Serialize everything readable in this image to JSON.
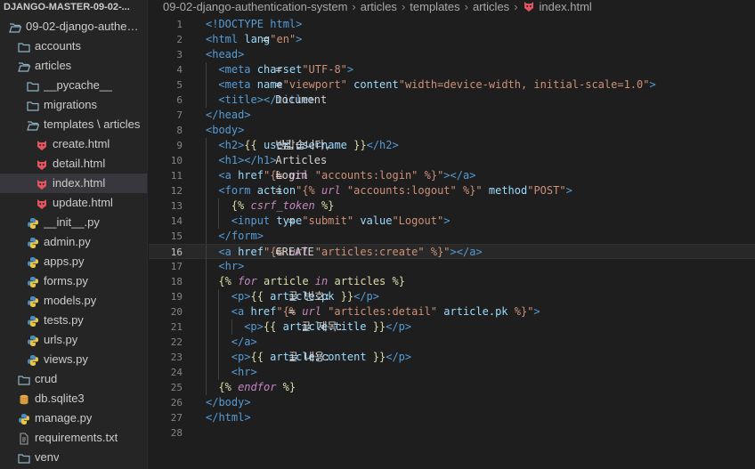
{
  "explorer": {
    "title": "DJANGO-MASTER-09-02-...",
    "items": [
      {
        "label": "09-02-django-authen...",
        "depth": 0,
        "type": "folder-open",
        "chevron": "▾"
      },
      {
        "label": "accounts",
        "depth": 1,
        "type": "folder",
        "chevron": "›"
      },
      {
        "label": "articles",
        "depth": 1,
        "type": "folder-open",
        "chevron": "▾"
      },
      {
        "label": "__pycache__",
        "depth": 2,
        "type": "folder",
        "chevron": "›"
      },
      {
        "label": "migrations",
        "depth": 2,
        "type": "folder",
        "chevron": "›"
      },
      {
        "label": "templates \\ articles",
        "depth": 2,
        "type": "folder-open",
        "chevron": "▾"
      },
      {
        "label": "create.html",
        "depth": 3,
        "type": "django"
      },
      {
        "label": "detail.html",
        "depth": 3,
        "type": "django"
      },
      {
        "label": "index.html",
        "depth": 3,
        "type": "django",
        "selected": true
      },
      {
        "label": "update.html",
        "depth": 3,
        "type": "django"
      },
      {
        "label": "__init__.py",
        "depth": 2,
        "type": "python"
      },
      {
        "label": "admin.py",
        "depth": 2,
        "type": "python"
      },
      {
        "label": "apps.py",
        "depth": 2,
        "type": "python"
      },
      {
        "label": "forms.py",
        "depth": 2,
        "type": "python"
      },
      {
        "label": "models.py",
        "depth": 2,
        "type": "python"
      },
      {
        "label": "tests.py",
        "depth": 2,
        "type": "python"
      },
      {
        "label": "urls.py",
        "depth": 2,
        "type": "python"
      },
      {
        "label": "views.py",
        "depth": 2,
        "type": "python"
      },
      {
        "label": "crud",
        "depth": 1,
        "type": "folder",
        "chevron": "›"
      },
      {
        "label": "db.sqlite3",
        "depth": 1,
        "type": "db"
      },
      {
        "label": "manage.py",
        "depth": 1,
        "type": "python"
      },
      {
        "label": "requirements.txt",
        "depth": 1,
        "type": "text"
      },
      {
        "label": "venv",
        "depth": 1,
        "type": "folder",
        "chevron": "›"
      }
    ]
  },
  "breadcrumb": {
    "parts": [
      "09-02-django-authentication-system",
      "articles",
      "templates",
      "articles",
      "index.html"
    ],
    "separator": "›"
  },
  "editor": {
    "active_line": 16,
    "lines": [
      {
        "n": "1",
        "indent": 0,
        "tokens": [
          [
            "tag",
            "<!DOCTYPE html>"
          ]
        ]
      },
      {
        "n": "2",
        "indent": 0,
        "tokens": [
          [
            "tag",
            "<html "
          ],
          [
            "attr",
            "lang"
          ],
          [
            "txt",
            "="
          ],
          [
            "str",
            "\"en\""
          ],
          [
            "tag",
            ">"
          ]
        ]
      },
      {
        "n": "3",
        "indent": 0,
        "tokens": [
          [
            "tag",
            "<head>"
          ]
        ]
      },
      {
        "n": "4",
        "indent": 1,
        "tokens": [
          [
            "tag",
            "<meta "
          ],
          [
            "attr",
            "charset"
          ],
          [
            "txt",
            "="
          ],
          [
            "str",
            "\"UTF-8\""
          ],
          [
            "tag",
            ">"
          ]
        ]
      },
      {
        "n": "5",
        "indent": 1,
        "tokens": [
          [
            "tag",
            "<meta "
          ],
          [
            "attr",
            "name"
          ],
          [
            "txt",
            "="
          ],
          [
            "str",
            "\"viewport\" "
          ],
          [
            "attr",
            "content"
          ],
          [
            "txt",
            "="
          ],
          [
            "str",
            "\"width=device-width, initial-scale=1.0\""
          ],
          [
            "tag",
            ">"
          ]
        ]
      },
      {
        "n": "6",
        "indent": 1,
        "tokens": [
          [
            "tag",
            "<title>"
          ],
          [
            "txt",
            "Document"
          ],
          [
            "tag",
            "</title>"
          ]
        ]
      },
      {
        "n": "7",
        "indent": 0,
        "tokens": [
          [
            "tag",
            "</head>"
          ]
        ]
      },
      {
        "n": "8",
        "indent": 0,
        "tokens": [
          [
            "tag",
            "<body>"
          ]
        ]
      },
      {
        "n": "9",
        "indent": 1,
        "tokens": [
          [
            "tag",
            "<h2>"
          ],
          [
            "txt",
            "반갑습니다, "
          ],
          [
            "tmpl",
            "{{ "
          ],
          [
            "var",
            "user.username"
          ],
          [
            "tmpl",
            " }}"
          ],
          [
            "txt",
            " 님"
          ],
          [
            "tag",
            "</h2>"
          ]
        ]
      },
      {
        "n": "10",
        "indent": 1,
        "tokens": [
          [
            "tag",
            "<h1>"
          ],
          [
            "txt",
            "Articles"
          ],
          [
            "tag",
            "</h1>"
          ]
        ]
      },
      {
        "n": "11",
        "indent": 1,
        "tokens": [
          [
            "tag",
            "<a "
          ],
          [
            "attr",
            "href"
          ],
          [
            "txt",
            "="
          ],
          [
            "str",
            "\"{% "
          ],
          [
            "ital",
            "url"
          ],
          [
            "str",
            " \"accounts:login\" %}\""
          ],
          [
            "tag",
            ">"
          ],
          [
            "txt",
            "Login"
          ],
          [
            "tag",
            "</a>"
          ]
        ]
      },
      {
        "n": "12",
        "indent": 1,
        "tokens": [
          [
            "tag",
            "<form "
          ],
          [
            "attr",
            "action"
          ],
          [
            "txt",
            "="
          ],
          [
            "str",
            "\"{% "
          ],
          [
            "ital",
            "url"
          ],
          [
            "str",
            " \"accounts:logout\" %}\" "
          ],
          [
            "attr",
            "method"
          ],
          [
            "txt",
            "="
          ],
          [
            "str",
            "\"POST\""
          ],
          [
            "tag",
            ">"
          ]
        ]
      },
      {
        "n": "13",
        "indent": 2,
        "tokens": [
          [
            "tmpl",
            "{% "
          ],
          [
            "ital",
            "csrf_token"
          ],
          [
            "tmpl",
            " %}"
          ]
        ]
      },
      {
        "n": "14",
        "indent": 2,
        "tokens": [
          [
            "tag",
            "<input "
          ],
          [
            "attr",
            "type"
          ],
          [
            "txt",
            "="
          ],
          [
            "str",
            "\"submit\" "
          ],
          [
            "attr",
            "value"
          ],
          [
            "txt",
            "="
          ],
          [
            "str",
            "\"Logout\""
          ],
          [
            "tag",
            ">"
          ]
        ]
      },
      {
        "n": "15",
        "indent": 1,
        "tokens": [
          [
            "tag",
            "</form>"
          ]
        ]
      },
      {
        "n": "16",
        "indent": 1,
        "tokens": [
          [
            "tag",
            "<a "
          ],
          [
            "attr",
            "href"
          ],
          [
            "txt",
            "="
          ],
          [
            "str",
            "\"{% "
          ],
          [
            "ital",
            "url"
          ],
          [
            "str",
            " \"articles:create\" %}\""
          ],
          [
            "tag",
            ">"
          ],
          [
            "txt",
            "CREATE"
          ],
          [
            "tag",
            "</a>"
          ]
        ]
      },
      {
        "n": "17",
        "indent": 1,
        "tokens": [
          [
            "tag",
            "<hr>"
          ]
        ]
      },
      {
        "n": "18",
        "indent": 1,
        "tokens": [
          [
            "tmpl",
            "{% "
          ],
          [
            "ital",
            "for"
          ],
          [
            "tmpl",
            " article "
          ],
          [
            "ital",
            "in"
          ],
          [
            "tmpl",
            " articles %}"
          ]
        ]
      },
      {
        "n": "19",
        "indent": 2,
        "tokens": [
          [
            "tag",
            "<p>"
          ],
          [
            "txt",
            "글 번호: "
          ],
          [
            "tmpl",
            "{{ "
          ],
          [
            "var",
            "article.pk"
          ],
          [
            "tmpl",
            " }}"
          ],
          [
            "tag",
            "</p>"
          ]
        ]
      },
      {
        "n": "20",
        "indent": 2,
        "tokens": [
          [
            "tag",
            "<a "
          ],
          [
            "attr",
            "href"
          ],
          [
            "txt",
            "="
          ],
          [
            "str",
            "\"{% "
          ],
          [
            "ital",
            "url"
          ],
          [
            "str",
            " \"articles:detail\" "
          ],
          [
            "var",
            "article.pk"
          ],
          [
            "str",
            " %}\""
          ],
          [
            "tag",
            ">"
          ]
        ]
      },
      {
        "n": "21",
        "indent": 3,
        "tokens": [
          [
            "tag",
            "<p>"
          ],
          [
            "txt",
            "글 제목: "
          ],
          [
            "tmpl",
            "{{ "
          ],
          [
            "var",
            "article.title"
          ],
          [
            "tmpl",
            " }}"
          ],
          [
            "tag",
            "</p>"
          ]
        ]
      },
      {
        "n": "22",
        "indent": 2,
        "tokens": [
          [
            "tag",
            "</a>"
          ]
        ]
      },
      {
        "n": "23",
        "indent": 2,
        "tokens": [
          [
            "tag",
            "<p>"
          ],
          [
            "txt",
            "글 내용: "
          ],
          [
            "tmpl",
            "{{ "
          ],
          [
            "var",
            "article.content"
          ],
          [
            "tmpl",
            " }}"
          ],
          [
            "tag",
            "</p>"
          ]
        ]
      },
      {
        "n": "24",
        "indent": 2,
        "tokens": [
          [
            "tag",
            "<hr>"
          ]
        ]
      },
      {
        "n": "25",
        "indent": 1,
        "tokens": [
          [
            "tmpl",
            "{% "
          ],
          [
            "ital",
            "endfor"
          ],
          [
            "tmpl",
            " %}"
          ]
        ]
      },
      {
        "n": "26",
        "indent": 0,
        "tokens": [
          [
            "tag",
            "</body>"
          ]
        ]
      },
      {
        "n": "27",
        "indent": 0,
        "tokens": [
          [
            "tag",
            "</html>"
          ]
        ]
      },
      {
        "n": "28",
        "indent": 0,
        "tokens": []
      }
    ]
  },
  "colors": {
    "background": "#1e1e1e",
    "sidebar": "#252526",
    "tag": "#569cd6",
    "attr": "#9cdcfe",
    "string": "#ce9178",
    "template": "#dcdcaa",
    "keyword": "#c586c0",
    "django_icon": "#e0555e",
    "python_icon": "#4b8bbe",
    "folder_icon": "#8db4c4"
  }
}
